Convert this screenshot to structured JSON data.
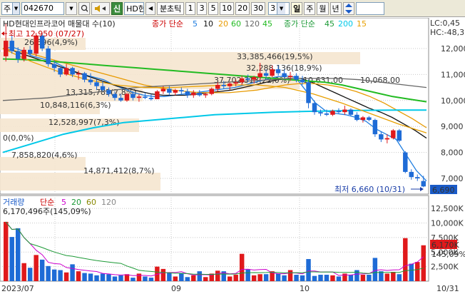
{
  "toolbar": {
    "market": "주",
    "code": "042670",
    "stock_short": "HD현",
    "badge": "신",
    "periods_label": "분초틱",
    "periods": [
      "1",
      "3",
      "5",
      "10",
      "20",
      "30"
    ],
    "interval_value": "3",
    "day": "일",
    "week": "주",
    "month": "월",
    "year": "년"
  },
  "price_panel": {
    "legend_title": "HD현대인프라코어 매물대 수(10)",
    "ma_legend_1_prefix": "종가 단순",
    "ma_legend_1": [
      {
        "label": "5",
        "color": "#1e7de0"
      },
      {
        "label": "10",
        "color": "#111111"
      },
      {
        "label": "20",
        "color": "#e89a00"
      },
      {
        "label": "60",
        "color": "#22bb22"
      },
      {
        "label": "120",
        "color": "#666666"
      },
      {
        "label": "45",
        "color": "#22bb22"
      }
    ],
    "ma_legend_2_prefix": "종가 단순",
    "ma_legend_2": [
      {
        "label": "45",
        "color": "#1c9a36"
      },
      {
        "label": "200",
        "color": "#00c8e8"
      },
      {
        "label": "15",
        "color": "#e8a000"
      }
    ],
    "high_label": "최고 12,950 (07/27)",
    "low_label": "최저 6,660 (10/31)",
    "lc_label": "LC:0,45",
    "hc_label": "HC:-48,3",
    "current_price": "6,690",
    "y_ticks": [
      "12,000",
      "11,000",
      "10,000",
      "9,000",
      "8,000",
      "7,000"
    ],
    "volume_profile": [
      "26,596(4,9%)",
      "33,385,466(19,5%)",
      "32,288,136(18,9%)",
      "37,702,313(22,0%)",
      "10,631,00",
      "10,068,00",
      "13,315,785(7,8%)",
      "10,848,116(6,3%)",
      "12,528,997(7,3%)",
      "0(0,0%)",
      "7,858,820(4,6%)",
      "14,871,412(8,7%)"
    ]
  },
  "volume_panel": {
    "legend_label": "거래량",
    "legend_prefix": "단순",
    "legend_ma": [
      {
        "label": "5",
        "color": "#cc00cc"
      },
      {
        "label": "20",
        "color": "#1c9a36"
      },
      {
        "label": "60",
        "color": "#888800"
      },
      {
        "label": "120",
        "color": "#888888"
      }
    ],
    "last_volume": "6,170,496주(145,09%)",
    "y_ticks": [
      "12,500K",
      "10,000K",
      "7,500K",
      "5,000K",
      "2,500K"
    ],
    "current_volume": "6,170K",
    "current_pct": "145,09%"
  },
  "x_axis": {
    "labels": [
      "2023/07",
      "09",
      "10",
      "10/31"
    ]
  },
  "colors": {
    "up": "#e0191b",
    "down": "#1e6bd6",
    "profile": "#f5e6cf",
    "grid": "#c8c8c8"
  },
  "chart_data": {
    "type": "candlestick",
    "candles": [
      {
        "o": 11700,
        "h": 12950,
        "l": 11500,
        "c": 12300
      },
      {
        "o": 12300,
        "h": 12500,
        "l": 11800,
        "c": 11900
      },
      {
        "o": 11900,
        "h": 12050,
        "l": 11450,
        "c": 11600
      },
      {
        "o": 11600,
        "h": 12050,
        "l": 11500,
        "c": 11950
      },
      {
        "o": 11950,
        "h": 12100,
        "l": 11700,
        "c": 11800
      },
      {
        "o": 11800,
        "h": 12600,
        "l": 11700,
        "c": 12500
      },
      {
        "o": 12500,
        "h": 12600,
        "l": 11900,
        "c": 12000
      },
      {
        "o": 12000,
        "h": 12100,
        "l": 11300,
        "c": 11400
      },
      {
        "o": 11400,
        "h": 11550,
        "l": 11100,
        "c": 11250
      },
      {
        "o": 11250,
        "h": 11300,
        "l": 10900,
        "c": 11000
      },
      {
        "o": 11000,
        "h": 11400,
        "l": 10950,
        "c": 11250
      },
      {
        "o": 11250,
        "h": 11300,
        "l": 10900,
        "c": 11000
      },
      {
        "o": 11000,
        "h": 11150,
        "l": 10800,
        "c": 11050
      },
      {
        "o": 11050,
        "h": 11100,
        "l": 10700,
        "c": 10800
      },
      {
        "o": 10800,
        "h": 11050,
        "l": 10600,
        "c": 10700
      },
      {
        "o": 10700,
        "h": 10800,
        "l": 10400,
        "c": 10550
      },
      {
        "o": 10550,
        "h": 10750,
        "l": 10350,
        "c": 10400
      },
      {
        "o": 10400,
        "h": 10500,
        "l": 10150,
        "c": 10250
      },
      {
        "o": 10250,
        "h": 10350,
        "l": 10000,
        "c": 10100
      },
      {
        "o": 10100,
        "h": 10250,
        "l": 9950,
        "c": 10000
      },
      {
        "o": 10000,
        "h": 10300,
        "l": 9950,
        "c": 10250
      },
      {
        "o": 10250,
        "h": 10350,
        "l": 10000,
        "c": 10100
      },
      {
        "o": 10100,
        "h": 10250,
        "l": 9950,
        "c": 10150
      },
      {
        "o": 10150,
        "h": 10300,
        "l": 10050,
        "c": 10100
      },
      {
        "o": 10100,
        "h": 10250,
        "l": 10000,
        "c": 10050
      },
      {
        "o": 10050,
        "h": 10400,
        "l": 10050,
        "c": 10350
      },
      {
        "o": 10350,
        "h": 10550,
        "l": 10250,
        "c": 10450
      },
      {
        "o": 10450,
        "h": 10550,
        "l": 10200,
        "c": 10300
      },
      {
        "o": 10300,
        "h": 10450,
        "l": 10200,
        "c": 10400
      },
      {
        "o": 10400,
        "h": 10500,
        "l": 10250,
        "c": 10350
      },
      {
        "o": 10350,
        "h": 10450,
        "l": 10100,
        "c": 10200
      },
      {
        "o": 10200,
        "h": 10400,
        "l": 10100,
        "c": 10300
      },
      {
        "o": 10300,
        "h": 10400,
        "l": 10150,
        "c": 10200
      },
      {
        "o": 10200,
        "h": 10300,
        "l": 10100,
        "c": 10250
      },
      {
        "o": 10250,
        "h": 10500,
        "l": 10200,
        "c": 10450
      },
      {
        "o": 10450,
        "h": 10700,
        "l": 10350,
        "c": 10600
      },
      {
        "o": 10600,
        "h": 10750,
        "l": 10450,
        "c": 10550
      },
      {
        "o": 10550,
        "h": 10700,
        "l": 10400,
        "c": 10650
      },
      {
        "o": 10650,
        "h": 10800,
        "l": 10550,
        "c": 10700
      },
      {
        "o": 10700,
        "h": 10950,
        "l": 10600,
        "c": 10850
      },
      {
        "o": 10850,
        "h": 11000,
        "l": 10700,
        "c": 10800
      },
      {
        "o": 10800,
        "h": 10950,
        "l": 10650,
        "c": 10900
      },
      {
        "o": 10900,
        "h": 11450,
        "l": 10800,
        "c": 11050
      },
      {
        "o": 11050,
        "h": 11200,
        "l": 10850,
        "c": 10950
      },
      {
        "o": 10950,
        "h": 11350,
        "l": 10900,
        "c": 11200
      },
      {
        "o": 11200,
        "h": 11350,
        "l": 10950,
        "c": 11050
      },
      {
        "o": 11050,
        "h": 11200,
        "l": 10850,
        "c": 10900
      },
      {
        "o": 10900,
        "h": 11100,
        "l": 10750,
        "c": 10950
      },
      {
        "o": 10950,
        "h": 11050,
        "l": 10700,
        "c": 10800
      },
      {
        "o": 10800,
        "h": 10950,
        "l": 10600,
        "c": 10700
      },
      {
        "o": 10700,
        "h": 10800,
        "l": 9700,
        "c": 9900
      },
      {
        "o": 9900,
        "h": 10000,
        "l": 9450,
        "c": 9550
      },
      {
        "o": 9550,
        "h": 9650,
        "l": 9400,
        "c": 9500
      },
      {
        "o": 9500,
        "h": 9650,
        "l": 9400,
        "c": 9450
      },
      {
        "o": 9450,
        "h": 9650,
        "l": 9400,
        "c": 9600
      },
      {
        "o": 9600,
        "h": 9700,
        "l": 9500,
        "c": 9550
      },
      {
        "o": 9550,
        "h": 9800,
        "l": 9450,
        "c": 9650
      },
      {
        "o": 9650,
        "h": 9700,
        "l": 9400,
        "c": 9450
      },
      {
        "o": 9450,
        "h": 9550,
        "l": 9200,
        "c": 9250
      },
      {
        "o": 9250,
        "h": 9400,
        "l": 9150,
        "c": 9350
      },
      {
        "o": 9350,
        "h": 9400,
        "l": 9200,
        "c": 9250
      },
      {
        "o": 9250,
        "h": 9300,
        "l": 8600,
        "c": 8700
      },
      {
        "o": 8700,
        "h": 8800,
        "l": 8400,
        "c": 8500
      },
      {
        "o": 8500,
        "h": 8700,
        "l": 8350,
        "c": 8550
      },
      {
        "o": 8550,
        "h": 8900,
        "l": 8500,
        "c": 8850
      },
      {
        "o": 8850,
        "h": 8900,
        "l": 8400,
        "c": 8450
      },
      {
        "o": 8000,
        "h": 8050,
        "l": 7200,
        "c": 7250
      },
      {
        "o": 7250,
        "h": 7350,
        "l": 6950,
        "c": 7050
      },
      {
        "o": 7050,
        "h": 7150,
        "l": 6900,
        "c": 7000
      },
      {
        "o": 6900,
        "h": 7100,
        "l": 6660,
        "c": 6690
      }
    ],
    "volumes_k": [
      10200,
      7600,
      9100,
      3100,
      2300,
      4500,
      3700,
      2600,
      2000,
      1900,
      1500,
      2900,
      1700,
      1400,
      1300,
      1000,
      1300,
      1200,
      800,
      1000,
      1200,
      600,
      1300,
      800,
      600,
      2500,
      2100,
      1400,
      800,
      1400,
      700,
      1000,
      1700,
      700,
      1300,
      1800,
      1700,
      800,
      1100,
      4700,
      2000,
      1000,
      1200,
      1200,
      1700,
      1300,
      1000,
      1900,
      1100,
      1000,
      3800,
      900,
      1100,
      1100,
      1000,
      800,
      1300,
      1100,
      1900,
      1100,
      1100,
      4000,
      1700,
      1300,
      1600,
      1200,
      7400,
      3000,
      3300,
      6170
    ],
    "volume_up": [
      true,
      false,
      false,
      true,
      false,
      true,
      false,
      false,
      false,
      false,
      true,
      false,
      true,
      false,
      false,
      false,
      false,
      false,
      false,
      false,
      true,
      false,
      true,
      false,
      false,
      true,
      true,
      false,
      true,
      false,
      false,
      true,
      false,
      true,
      true,
      true,
      false,
      true,
      true,
      true,
      false,
      true,
      true,
      false,
      true,
      false,
      false,
      true,
      false,
      false,
      false,
      false,
      false,
      false,
      true,
      false,
      true,
      false,
      false,
      true,
      false,
      false,
      false,
      true,
      true,
      false,
      true,
      false,
      true,
      true
    ],
    "ma_series": [
      {
        "name": "5",
        "color": "#1e7de0",
        "points": [
          12000,
          12050,
          11900,
          11700,
          11600,
          11500,
          11300,
          11100,
          11000,
          10900,
          10800,
          10600,
          10450,
          10300,
          10200,
          10150,
          10150,
          10200,
          10250,
          10300,
          10350,
          10400,
          10450,
          10500,
          10600,
          10700,
          10800,
          10900,
          10950,
          10900,
          10400,
          9900,
          9600,
          9500,
          9450,
          9350,
          9200,
          8900,
          8700,
          8500,
          7900,
          7300,
          6900
        ]
      },
      {
        "name": "10",
        "color": "#111111",
        "points": [
          12000,
          11900,
          11750,
          11600,
          11450,
          11300,
          11150,
          11000,
          10850,
          10700,
          10550,
          10450,
          10350,
          10250,
          10200,
          10200,
          10200,
          10250,
          10300,
          10350,
          10400,
          10500,
          10600,
          10700,
          10800,
          10850,
          10850,
          10700,
          10500,
          10300,
          10100,
          9900,
          9700,
          9550,
          9350,
          9100,
          8850,
          8550
        ]
      },
      {
        "name": "20",
        "color": "#e89a00",
        "points": [
          12000,
          11900,
          11800,
          11650,
          11500,
          11350,
          11200,
          11050,
          10900,
          10750,
          10600,
          10500,
          10400,
          10350,
          10300,
          10300,
          10300,
          10350,
          10400,
          10500,
          10600,
          10650,
          10650,
          10600,
          10500,
          10350,
          10150,
          9900,
          9600,
          9300,
          8950
        ]
      },
      {
        "name": "60",
        "color": "#22bb22",
        "points": [
          11600,
          11580,
          11550,
          11500,
          11450,
          11400,
          11350,
          11300,
          11250,
          11200,
          11150,
          11100,
          11050,
          11000,
          10950,
          10900,
          10850,
          10800,
          10750,
          10700,
          10600,
          10450,
          10300,
          10150,
          10050,
          9950
        ]
      },
      {
        "name": "120",
        "color": "#666666",
        "points": [
          10000,
          10050,
          10100,
          10200,
          10300,
          10400,
          10500,
          10550,
          10600,
          10650,
          10700,
          10750,
          10800,
          10850,
          10850,
          10850,
          10800,
          10700,
          10600,
          10500
        ]
      },
      {
        "name": "200",
        "color": "#00c8e8",
        "points": [
          8000,
          8350,
          8700,
          8950,
          9150,
          9250,
          9350,
          9450,
          9500,
          9550,
          9580,
          9600,
          9620,
          9630,
          9630
        ]
      },
      {
        "name": "15",
        "color": "#e8a000",
        "points": [
          12000,
          11500,
          11100,
          10800,
          10600,
          10500,
          10500,
          10550,
          10600,
          10600,
          10500,
          10250,
          9900,
          9500,
          9100,
          8750
        ]
      }
    ]
  }
}
